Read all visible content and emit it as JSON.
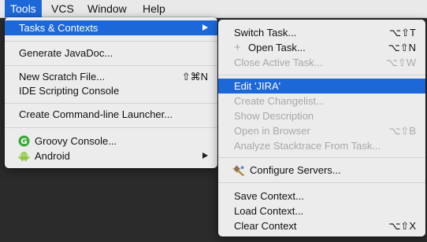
{
  "menubar": {
    "items": [
      {
        "label": "Tools"
      },
      {
        "label": "VCS"
      },
      {
        "label": "Window"
      },
      {
        "label": "Help"
      }
    ]
  },
  "tools_menu": {
    "tasks_contexts": "Tasks & Contexts",
    "generate_javadoc": "Generate JavaDoc...",
    "new_scratch_file": "New Scratch File...",
    "new_scratch_file_shortcut": "⇧⌘N",
    "ide_scripting_console": "IDE Scripting Console",
    "create_cli_launcher": "Create Command-line Launcher...",
    "groovy_console": "Groovy Console...",
    "android": "Android"
  },
  "submenu": {
    "switch_task": "Switch Task...",
    "switch_task_shortcut": "⌥⇧T",
    "open_task_plus": "+",
    "open_task": "Open Task...",
    "open_task_shortcut": "⌥⇧N",
    "close_active_task": "Close Active Task...",
    "close_active_task_shortcut": "⌥⇧W",
    "edit_jira": "Edit 'JIRA'",
    "create_changelist": "Create Changelist...",
    "show_description": "Show Description",
    "open_in_browser": "Open in Browser",
    "open_in_browser_shortcut": "⌥⇧B",
    "analyze_stacktrace": "Analyze Stacktrace From Task...",
    "configure_servers": "Configure Servers...",
    "save_context": "Save Context...",
    "load_context": "Load Context...",
    "clear_context": "Clear Context",
    "clear_context_shortcut": "⌥⇧X"
  },
  "colors": {
    "highlight": "#1c68d9",
    "menu_bg": "#ececec",
    "disabled_text": "#a8a8a8",
    "groovy_icon": "#3fa83d",
    "android_icon": "#8dc63f"
  }
}
